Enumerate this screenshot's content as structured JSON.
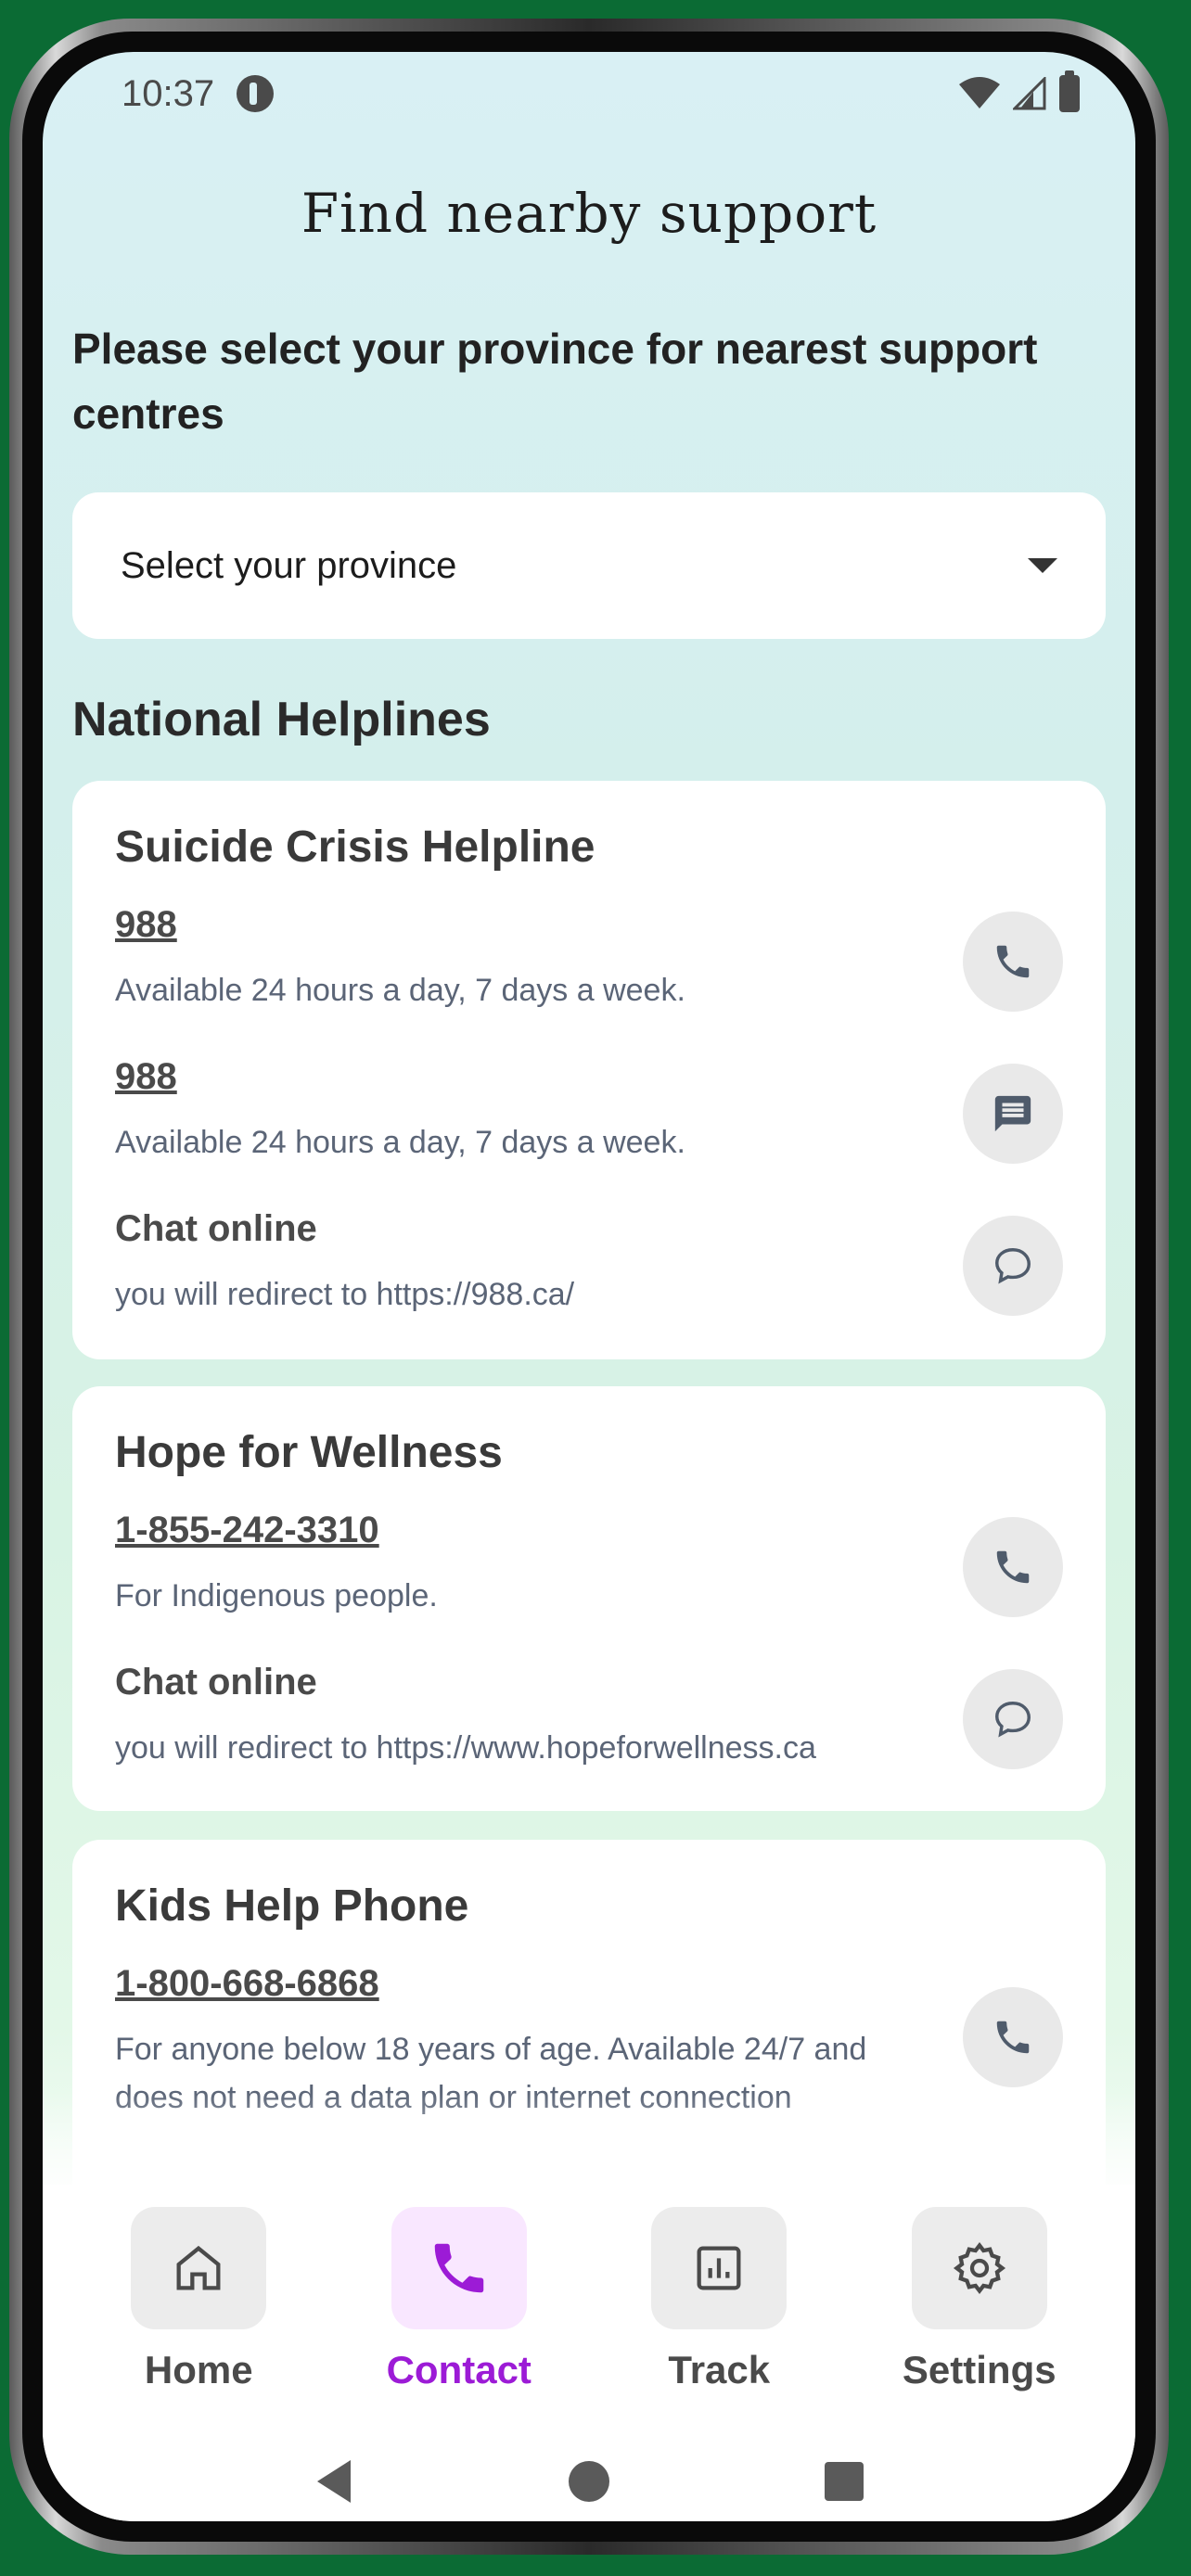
{
  "status_bar": {
    "time": "10:37"
  },
  "header": {
    "title": "Find nearby support"
  },
  "intro_text": "Please select your province for nearest support centres",
  "province_select": {
    "placeholder": "Select your province"
  },
  "section_title": "National Helplines",
  "cards": [
    {
      "title": "Suicide Crisis Helpline",
      "entries": [
        {
          "main": "988",
          "sub": "Available 24 hours a day, 7 days a week.",
          "icon": "phone-icon"
        },
        {
          "main": "988",
          "sub": "Available 24 hours a day, 7 days a week.",
          "icon": "sms-icon"
        },
        {
          "main": "Chat online",
          "sub": "you will redirect to https://988.ca/",
          "icon": "chat-bubble-icon"
        }
      ]
    },
    {
      "title": "Hope for Wellness",
      "entries": [
        {
          "main": "1-855-242-3310",
          "sub": "For Indigenous people.",
          "icon": "phone-icon"
        },
        {
          "main": "Chat online",
          "sub": "you will redirect to https://www.hopeforwellness.ca",
          "icon": "chat-bubble-icon"
        }
      ]
    },
    {
      "title": "Kids Help Phone",
      "entries": [
        {
          "main": "1-800-668-6868",
          "sub": "For anyone below 18 years of age. Available 24/7 and does not need a data plan or internet connection",
          "icon": "phone-icon"
        }
      ]
    }
  ],
  "bottom_nav": {
    "items": [
      {
        "label": "Home",
        "icon": "home-icon",
        "active": false
      },
      {
        "label": "Contact",
        "icon": "phone-icon",
        "active": true
      },
      {
        "label": "Track",
        "icon": "chart-icon",
        "active": false
      },
      {
        "label": "Settings",
        "icon": "gear-icon",
        "active": false
      }
    ]
  },
  "colors": {
    "accent": "#9c1bd6",
    "accent_bg": "#f9e7ff",
    "frame_bg": "#0b6b34"
  }
}
